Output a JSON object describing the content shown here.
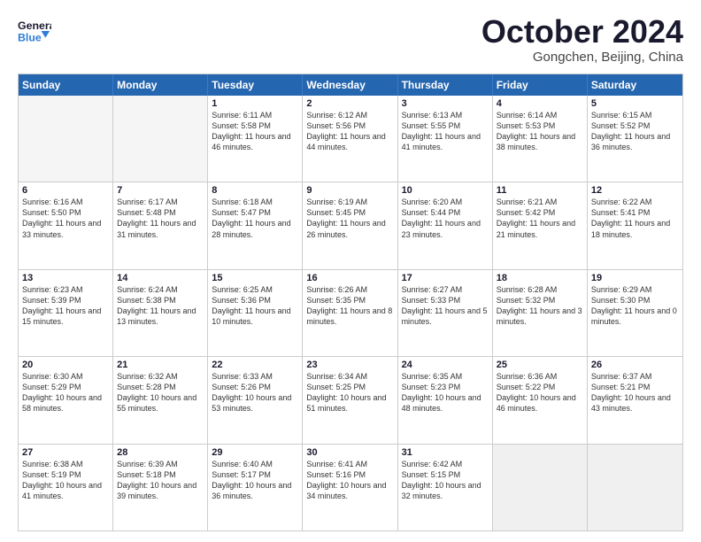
{
  "header": {
    "logo_general": "General",
    "logo_blue": "Blue",
    "month_title": "October 2024",
    "subtitle": "Gongchen, Beijing, China"
  },
  "days_of_week": [
    "Sunday",
    "Monday",
    "Tuesday",
    "Wednesday",
    "Thursday",
    "Friday",
    "Saturday"
  ],
  "weeks": [
    [
      {
        "day": "",
        "sunrise": "",
        "sunset": "",
        "daylight": "",
        "empty": true
      },
      {
        "day": "",
        "sunrise": "",
        "sunset": "",
        "daylight": "",
        "empty": true
      },
      {
        "day": "1",
        "sunrise": "Sunrise: 6:11 AM",
        "sunset": "Sunset: 5:58 PM",
        "daylight": "Daylight: 11 hours and 46 minutes.",
        "empty": false
      },
      {
        "day": "2",
        "sunrise": "Sunrise: 6:12 AM",
        "sunset": "Sunset: 5:56 PM",
        "daylight": "Daylight: 11 hours and 44 minutes.",
        "empty": false
      },
      {
        "day": "3",
        "sunrise": "Sunrise: 6:13 AM",
        "sunset": "Sunset: 5:55 PM",
        "daylight": "Daylight: 11 hours and 41 minutes.",
        "empty": false
      },
      {
        "day": "4",
        "sunrise": "Sunrise: 6:14 AM",
        "sunset": "Sunset: 5:53 PM",
        "daylight": "Daylight: 11 hours and 38 minutes.",
        "empty": false
      },
      {
        "day": "5",
        "sunrise": "Sunrise: 6:15 AM",
        "sunset": "Sunset: 5:52 PM",
        "daylight": "Daylight: 11 hours and 36 minutes.",
        "empty": false
      }
    ],
    [
      {
        "day": "6",
        "sunrise": "Sunrise: 6:16 AM",
        "sunset": "Sunset: 5:50 PM",
        "daylight": "Daylight: 11 hours and 33 minutes.",
        "empty": false
      },
      {
        "day": "7",
        "sunrise": "Sunrise: 6:17 AM",
        "sunset": "Sunset: 5:48 PM",
        "daylight": "Daylight: 11 hours and 31 minutes.",
        "empty": false
      },
      {
        "day": "8",
        "sunrise": "Sunrise: 6:18 AM",
        "sunset": "Sunset: 5:47 PM",
        "daylight": "Daylight: 11 hours and 28 minutes.",
        "empty": false
      },
      {
        "day": "9",
        "sunrise": "Sunrise: 6:19 AM",
        "sunset": "Sunset: 5:45 PM",
        "daylight": "Daylight: 11 hours and 26 minutes.",
        "empty": false
      },
      {
        "day": "10",
        "sunrise": "Sunrise: 6:20 AM",
        "sunset": "Sunset: 5:44 PM",
        "daylight": "Daylight: 11 hours and 23 minutes.",
        "empty": false
      },
      {
        "day": "11",
        "sunrise": "Sunrise: 6:21 AM",
        "sunset": "Sunset: 5:42 PM",
        "daylight": "Daylight: 11 hours and 21 minutes.",
        "empty": false
      },
      {
        "day": "12",
        "sunrise": "Sunrise: 6:22 AM",
        "sunset": "Sunset: 5:41 PM",
        "daylight": "Daylight: 11 hours and 18 minutes.",
        "empty": false
      }
    ],
    [
      {
        "day": "13",
        "sunrise": "Sunrise: 6:23 AM",
        "sunset": "Sunset: 5:39 PM",
        "daylight": "Daylight: 11 hours and 15 minutes.",
        "empty": false
      },
      {
        "day": "14",
        "sunrise": "Sunrise: 6:24 AM",
        "sunset": "Sunset: 5:38 PM",
        "daylight": "Daylight: 11 hours and 13 minutes.",
        "empty": false
      },
      {
        "day": "15",
        "sunrise": "Sunrise: 6:25 AM",
        "sunset": "Sunset: 5:36 PM",
        "daylight": "Daylight: 11 hours and 10 minutes.",
        "empty": false
      },
      {
        "day": "16",
        "sunrise": "Sunrise: 6:26 AM",
        "sunset": "Sunset: 5:35 PM",
        "daylight": "Daylight: 11 hours and 8 minutes.",
        "empty": false
      },
      {
        "day": "17",
        "sunrise": "Sunrise: 6:27 AM",
        "sunset": "Sunset: 5:33 PM",
        "daylight": "Daylight: 11 hours and 5 minutes.",
        "empty": false
      },
      {
        "day": "18",
        "sunrise": "Sunrise: 6:28 AM",
        "sunset": "Sunset: 5:32 PM",
        "daylight": "Daylight: 11 hours and 3 minutes.",
        "empty": false
      },
      {
        "day": "19",
        "sunrise": "Sunrise: 6:29 AM",
        "sunset": "Sunset: 5:30 PM",
        "daylight": "Daylight: 11 hours and 0 minutes.",
        "empty": false
      }
    ],
    [
      {
        "day": "20",
        "sunrise": "Sunrise: 6:30 AM",
        "sunset": "Sunset: 5:29 PM",
        "daylight": "Daylight: 10 hours and 58 minutes.",
        "empty": false
      },
      {
        "day": "21",
        "sunrise": "Sunrise: 6:32 AM",
        "sunset": "Sunset: 5:28 PM",
        "daylight": "Daylight: 10 hours and 55 minutes.",
        "empty": false
      },
      {
        "day": "22",
        "sunrise": "Sunrise: 6:33 AM",
        "sunset": "Sunset: 5:26 PM",
        "daylight": "Daylight: 10 hours and 53 minutes.",
        "empty": false
      },
      {
        "day": "23",
        "sunrise": "Sunrise: 6:34 AM",
        "sunset": "Sunset: 5:25 PM",
        "daylight": "Daylight: 10 hours and 51 minutes.",
        "empty": false
      },
      {
        "day": "24",
        "sunrise": "Sunrise: 6:35 AM",
        "sunset": "Sunset: 5:23 PM",
        "daylight": "Daylight: 10 hours and 48 minutes.",
        "empty": false
      },
      {
        "day": "25",
        "sunrise": "Sunrise: 6:36 AM",
        "sunset": "Sunset: 5:22 PM",
        "daylight": "Daylight: 10 hours and 46 minutes.",
        "empty": false
      },
      {
        "day": "26",
        "sunrise": "Sunrise: 6:37 AM",
        "sunset": "Sunset: 5:21 PM",
        "daylight": "Daylight: 10 hours and 43 minutes.",
        "empty": false
      }
    ],
    [
      {
        "day": "27",
        "sunrise": "Sunrise: 6:38 AM",
        "sunset": "Sunset: 5:19 PM",
        "daylight": "Daylight: 10 hours and 41 minutes.",
        "empty": false
      },
      {
        "day": "28",
        "sunrise": "Sunrise: 6:39 AM",
        "sunset": "Sunset: 5:18 PM",
        "daylight": "Daylight: 10 hours and 39 minutes.",
        "empty": false
      },
      {
        "day": "29",
        "sunrise": "Sunrise: 6:40 AM",
        "sunset": "Sunset: 5:17 PM",
        "daylight": "Daylight: 10 hours and 36 minutes.",
        "empty": false
      },
      {
        "day": "30",
        "sunrise": "Sunrise: 6:41 AM",
        "sunset": "Sunset: 5:16 PM",
        "daylight": "Daylight: 10 hours and 34 minutes.",
        "empty": false
      },
      {
        "day": "31",
        "sunrise": "Sunrise: 6:42 AM",
        "sunset": "Sunset: 5:15 PM",
        "daylight": "Daylight: 10 hours and 32 minutes.",
        "empty": false
      },
      {
        "day": "",
        "sunrise": "",
        "sunset": "",
        "daylight": "",
        "empty": true
      },
      {
        "day": "",
        "sunrise": "",
        "sunset": "",
        "daylight": "",
        "empty": true
      }
    ]
  ]
}
